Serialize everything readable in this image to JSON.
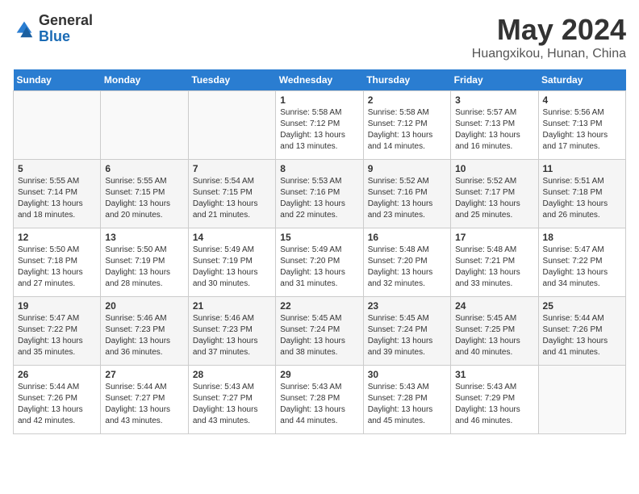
{
  "logo": {
    "general": "General",
    "blue": "Blue"
  },
  "title": "May 2024",
  "subtitle": "Huangxikou, Hunan, China",
  "days_header": [
    "Sunday",
    "Monday",
    "Tuesday",
    "Wednesday",
    "Thursday",
    "Friday",
    "Saturday"
  ],
  "weeks": [
    {
      "days": [
        {
          "num": "",
          "info": ""
        },
        {
          "num": "",
          "info": ""
        },
        {
          "num": "",
          "info": ""
        },
        {
          "num": "1",
          "info": "Sunrise: 5:58 AM\nSunset: 7:12 PM\nDaylight: 13 hours\nand 13 minutes."
        },
        {
          "num": "2",
          "info": "Sunrise: 5:58 AM\nSunset: 7:12 PM\nDaylight: 13 hours\nand 14 minutes."
        },
        {
          "num": "3",
          "info": "Sunrise: 5:57 AM\nSunset: 7:13 PM\nDaylight: 13 hours\nand 16 minutes."
        },
        {
          "num": "4",
          "info": "Sunrise: 5:56 AM\nSunset: 7:13 PM\nDaylight: 13 hours\nand 17 minutes."
        }
      ]
    },
    {
      "days": [
        {
          "num": "5",
          "info": "Sunrise: 5:55 AM\nSunset: 7:14 PM\nDaylight: 13 hours\nand 18 minutes."
        },
        {
          "num": "6",
          "info": "Sunrise: 5:55 AM\nSunset: 7:15 PM\nDaylight: 13 hours\nand 20 minutes."
        },
        {
          "num": "7",
          "info": "Sunrise: 5:54 AM\nSunset: 7:15 PM\nDaylight: 13 hours\nand 21 minutes."
        },
        {
          "num": "8",
          "info": "Sunrise: 5:53 AM\nSunset: 7:16 PM\nDaylight: 13 hours\nand 22 minutes."
        },
        {
          "num": "9",
          "info": "Sunrise: 5:52 AM\nSunset: 7:16 PM\nDaylight: 13 hours\nand 23 minutes."
        },
        {
          "num": "10",
          "info": "Sunrise: 5:52 AM\nSunset: 7:17 PM\nDaylight: 13 hours\nand 25 minutes."
        },
        {
          "num": "11",
          "info": "Sunrise: 5:51 AM\nSunset: 7:18 PM\nDaylight: 13 hours\nand 26 minutes."
        }
      ]
    },
    {
      "days": [
        {
          "num": "12",
          "info": "Sunrise: 5:50 AM\nSunset: 7:18 PM\nDaylight: 13 hours\nand 27 minutes."
        },
        {
          "num": "13",
          "info": "Sunrise: 5:50 AM\nSunset: 7:19 PM\nDaylight: 13 hours\nand 28 minutes."
        },
        {
          "num": "14",
          "info": "Sunrise: 5:49 AM\nSunset: 7:19 PM\nDaylight: 13 hours\nand 30 minutes."
        },
        {
          "num": "15",
          "info": "Sunrise: 5:49 AM\nSunset: 7:20 PM\nDaylight: 13 hours\nand 31 minutes."
        },
        {
          "num": "16",
          "info": "Sunrise: 5:48 AM\nSunset: 7:20 PM\nDaylight: 13 hours\nand 32 minutes."
        },
        {
          "num": "17",
          "info": "Sunrise: 5:48 AM\nSunset: 7:21 PM\nDaylight: 13 hours\nand 33 minutes."
        },
        {
          "num": "18",
          "info": "Sunrise: 5:47 AM\nSunset: 7:22 PM\nDaylight: 13 hours\nand 34 minutes."
        }
      ]
    },
    {
      "days": [
        {
          "num": "19",
          "info": "Sunrise: 5:47 AM\nSunset: 7:22 PM\nDaylight: 13 hours\nand 35 minutes."
        },
        {
          "num": "20",
          "info": "Sunrise: 5:46 AM\nSunset: 7:23 PM\nDaylight: 13 hours\nand 36 minutes."
        },
        {
          "num": "21",
          "info": "Sunrise: 5:46 AM\nSunset: 7:23 PM\nDaylight: 13 hours\nand 37 minutes."
        },
        {
          "num": "22",
          "info": "Sunrise: 5:45 AM\nSunset: 7:24 PM\nDaylight: 13 hours\nand 38 minutes."
        },
        {
          "num": "23",
          "info": "Sunrise: 5:45 AM\nSunset: 7:24 PM\nDaylight: 13 hours\nand 39 minutes."
        },
        {
          "num": "24",
          "info": "Sunrise: 5:45 AM\nSunset: 7:25 PM\nDaylight: 13 hours\nand 40 minutes."
        },
        {
          "num": "25",
          "info": "Sunrise: 5:44 AM\nSunset: 7:26 PM\nDaylight: 13 hours\nand 41 minutes."
        }
      ]
    },
    {
      "days": [
        {
          "num": "26",
          "info": "Sunrise: 5:44 AM\nSunset: 7:26 PM\nDaylight: 13 hours\nand 42 minutes."
        },
        {
          "num": "27",
          "info": "Sunrise: 5:44 AM\nSunset: 7:27 PM\nDaylight: 13 hours\nand 43 minutes."
        },
        {
          "num": "28",
          "info": "Sunrise: 5:43 AM\nSunset: 7:27 PM\nDaylight: 13 hours\nand 43 minutes."
        },
        {
          "num": "29",
          "info": "Sunrise: 5:43 AM\nSunset: 7:28 PM\nDaylight: 13 hours\nand 44 minutes."
        },
        {
          "num": "30",
          "info": "Sunrise: 5:43 AM\nSunset: 7:28 PM\nDaylight: 13 hours\nand 45 minutes."
        },
        {
          "num": "31",
          "info": "Sunrise: 5:43 AM\nSunset: 7:29 PM\nDaylight: 13 hours\nand 46 minutes."
        },
        {
          "num": "",
          "info": ""
        }
      ]
    }
  ]
}
